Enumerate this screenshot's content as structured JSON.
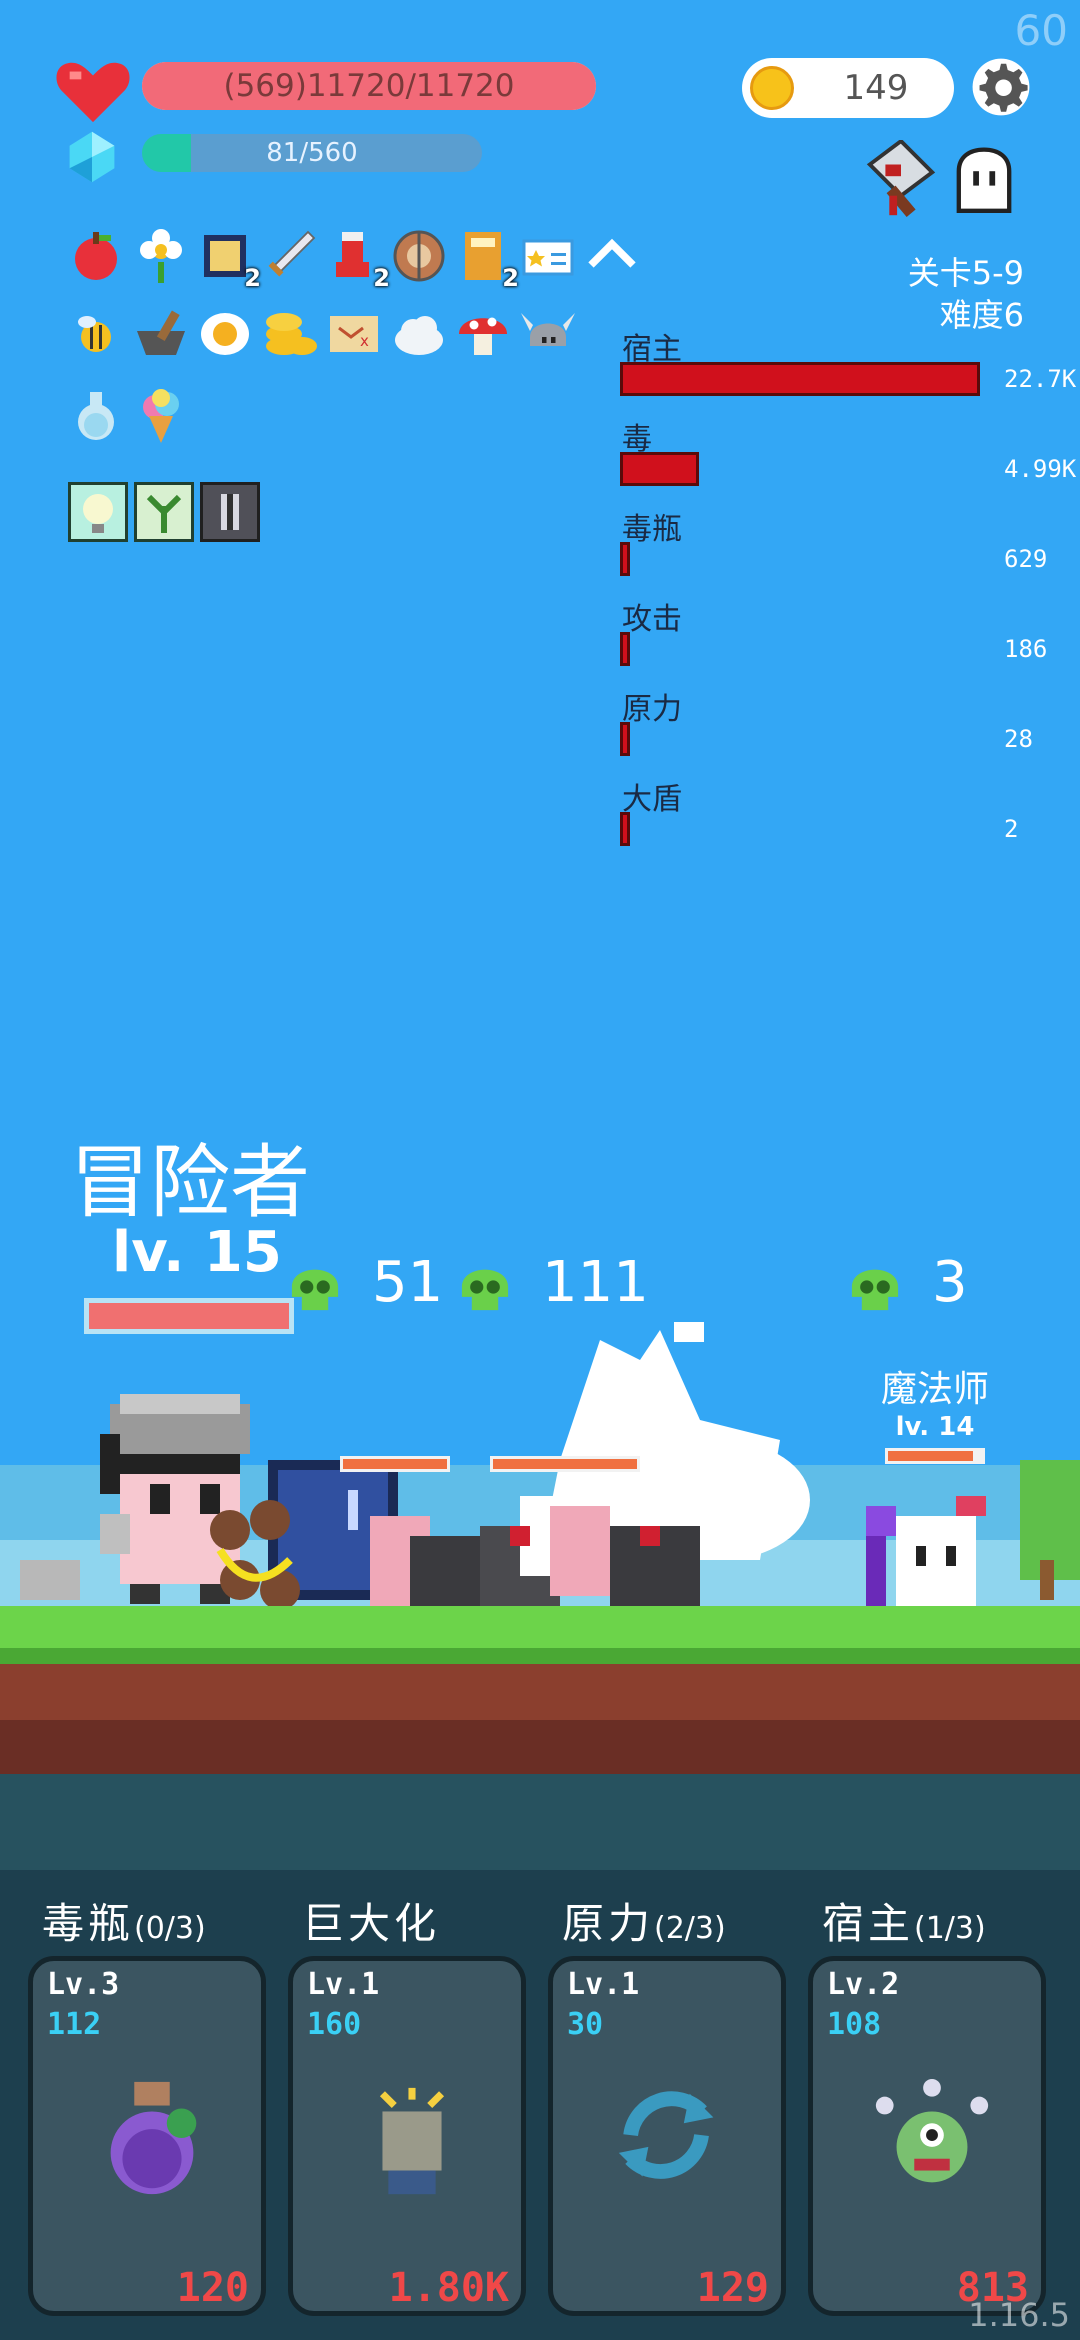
{
  "fps": "60",
  "player": {
    "hp_text": "(569)11720/11720",
    "hp_fraction": 1.0,
    "mp_text": "81/560",
    "mp_fraction": 0.145
  },
  "coins": "149",
  "stage": {
    "level": "关卡5-9",
    "difficulty": "难度6"
  },
  "items_row1": [
    {
      "icon": "apple-icon"
    },
    {
      "icon": "flower-icon"
    },
    {
      "icon": "scroll-card-icon",
      "count": "2"
    },
    {
      "icon": "sword-icon"
    },
    {
      "icon": "boot-icon",
      "count": "2"
    },
    {
      "icon": "shield-icon"
    },
    {
      "icon": "book-icon",
      "count": "2"
    },
    {
      "icon": "id-card-icon"
    },
    {
      "icon": "collapse-chevron-icon"
    }
  ],
  "items_row2": [
    {
      "icon": "bee-icon"
    },
    {
      "icon": "mortar-icon"
    },
    {
      "icon": "fried-egg-icon"
    },
    {
      "icon": "coin-stack-icon"
    },
    {
      "icon": "treasure-map-icon"
    },
    {
      "icon": "cloud-icon"
    },
    {
      "icon": "mushroom-icon"
    },
    {
      "icon": "viking-helmet-icon"
    }
  ],
  "items_row3": [
    {
      "icon": "potion-flask-icon"
    },
    {
      "icon": "ice-cream-icon"
    }
  ],
  "skills_row": [
    {
      "icon": "lightbulb-skill-icon"
    },
    {
      "icon": "sprout-skill-icon"
    },
    {
      "icon": "dark-skill-icon"
    }
  ],
  "damage_stats": [
    {
      "label": "宿主",
      "value": "22.7K",
      "amount": 22700
    },
    {
      "label": "毒",
      "value": "4.99K",
      "amount": 4990
    },
    {
      "label": "毒瓶",
      "value": "629",
      "amount": 629
    },
    {
      "label": "攻击",
      "value": "186",
      "amount": 186
    },
    {
      "label": "原力",
      "value": "28",
      "amount": 28
    },
    {
      "label": "大盾",
      "value": "2",
      "amount": 2
    }
  ],
  "hero": {
    "name": "冒险者",
    "level": "lv. 15",
    "hp_fraction": 1.0
  },
  "enemy_groups": [
    {
      "count": "51"
    },
    {
      "count": "111"
    },
    {
      "count": "3"
    }
  ],
  "enemy_labels": [
    {
      "name": "魔法师",
      "level": "lv. 14",
      "hp_fraction": 0.9
    }
  ],
  "skill_cards": [
    {
      "name": "毒瓶",
      "progress": "(0/3)",
      "level": "Lv.3",
      "value": "112",
      "cost": "120",
      "icon": "poison-bottle-icon"
    },
    {
      "name": "巨大化",
      "progress": "",
      "level": "Lv.1",
      "value": "160",
      "cost": "1.80K",
      "icon": "fist-icon"
    },
    {
      "name": "原力",
      "progress": "(2/3)",
      "level": "Lv.1",
      "value": "30",
      "cost": "129",
      "icon": "cycle-arrows-icon"
    },
    {
      "name": "宿主",
      "progress": "(1/3)",
      "level": "Lv.2",
      "value": "108",
      "cost": "813",
      "icon": "parasite-monster-icon"
    }
  ],
  "version": "1.16.5",
  "colors": {
    "sky": "#33a7f5",
    "hp": "#f26a78",
    "mp": "#22c8a8",
    "damage_bar": "#d0101c",
    "card_cost": "#f04848",
    "card_value": "#3ad0f5"
  }
}
